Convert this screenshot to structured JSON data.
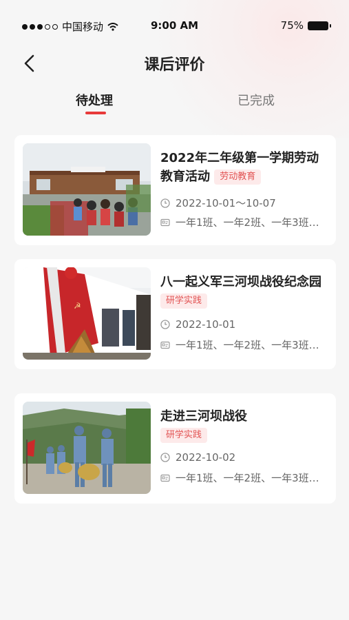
{
  "status_bar": {
    "carrier": "中国移动",
    "time": "9:00 AM",
    "battery": "75%"
  },
  "header": {
    "title": "课后评价"
  },
  "tabs": [
    {
      "label": "待处理",
      "active": true
    },
    {
      "label": "已完成",
      "active": false
    }
  ],
  "activities": [
    {
      "title": "2022年二年级第一学期劳动教育活动",
      "tag": "劳动教育",
      "date": "2022-10-01～10-07",
      "classes": "一年1班、一年2班、一年3班…",
      "image_icon": "school-entrance-photo"
    },
    {
      "title": "八一起义军三河坝战役纪念园",
      "tag": "研学实践",
      "date": "2022-10-01",
      "classes": "一年1班、一年2班、一年3班…",
      "image_icon": "memorial-wall-photo"
    },
    {
      "title": "走进三河坝战役",
      "tag": "研学实践",
      "date": "2022-10-02",
      "classes": "一年1班、一年2班、一年3班…",
      "image_icon": "reenactment-march-photo"
    }
  ],
  "colors": {
    "accent": "#e83a3a",
    "tag_bg": "#fdeaea",
    "tag_text": "#e25454"
  }
}
